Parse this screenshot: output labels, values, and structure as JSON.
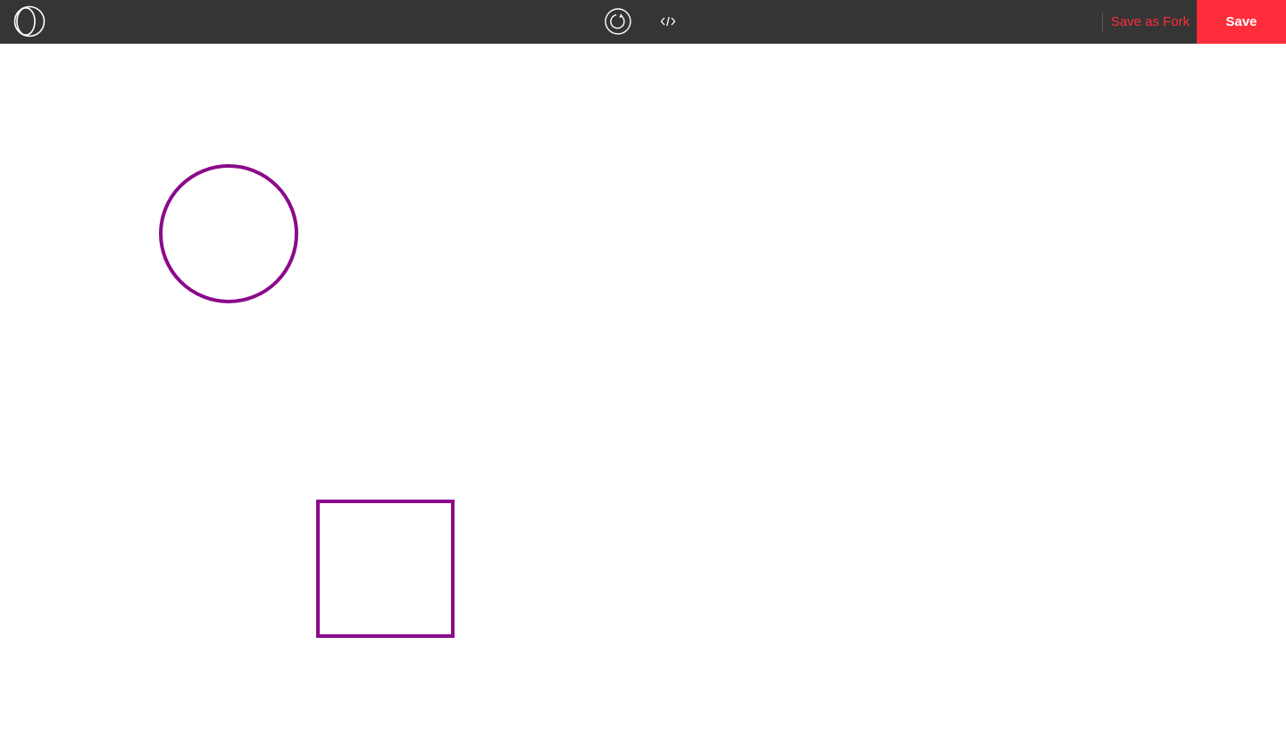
{
  "toolbar": {
    "save_as_fork_label": "Save as Fork",
    "save_label": "Save"
  },
  "icons": {
    "logo": "logo-icon",
    "refresh": "refresh-icon",
    "code": "code-icon"
  },
  "colors": {
    "topbar_bg": "#353535",
    "accent": "#fe2d3b",
    "shape_stroke": "#8b0a8b",
    "canvas_bg": "#ffffff"
  },
  "canvas": {
    "shapes": [
      "circle",
      "square"
    ]
  }
}
